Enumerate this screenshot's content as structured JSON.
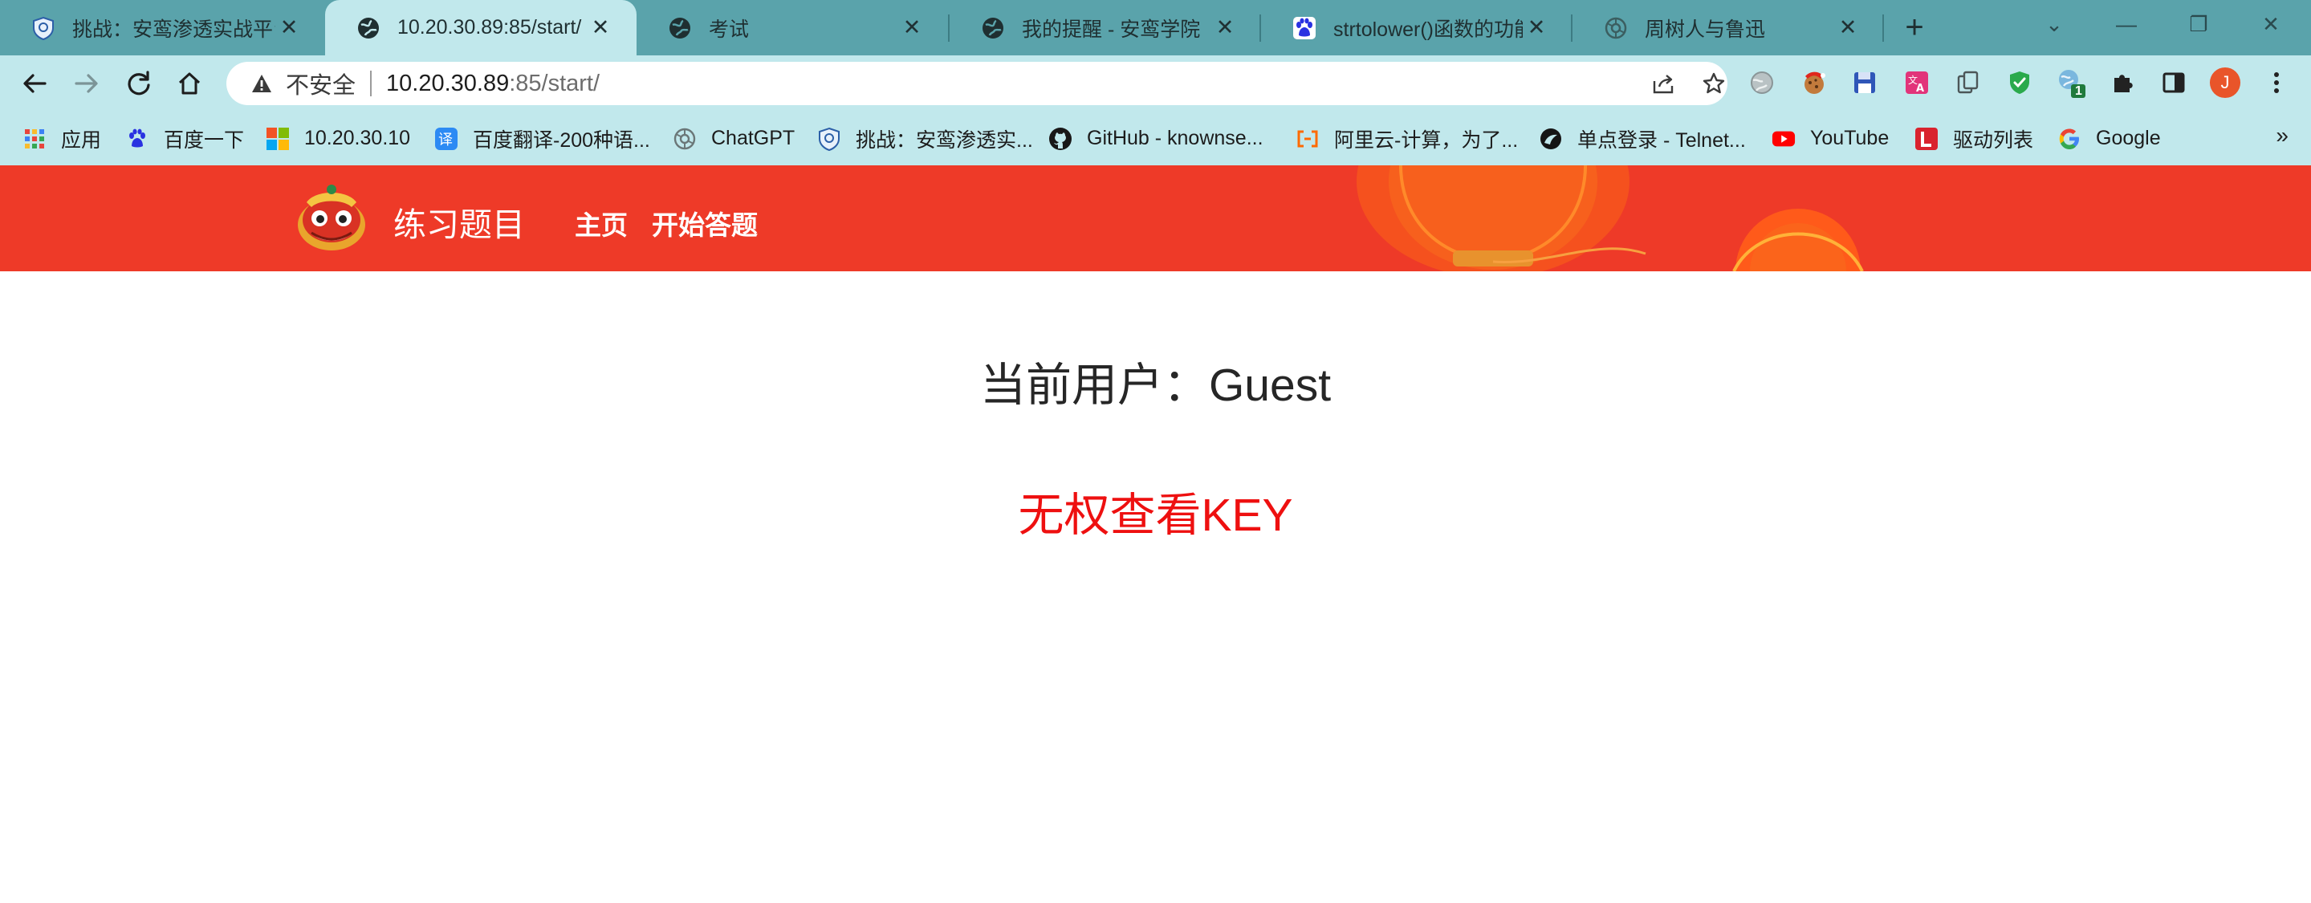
{
  "browser": {
    "tabs": [
      {
        "title": "挑战：安鸾渗透实战平台",
        "icon": "shield-icon",
        "active": false
      },
      {
        "title": "10.20.30.89:85/start/",
        "icon": "globe-icon",
        "active": true
      },
      {
        "title": "考试",
        "icon": "globe-icon",
        "active": false
      },
      {
        "title": "我的提醒 - 安鸾学院",
        "icon": "globe-icon",
        "active": false
      },
      {
        "title": "strtolower()函数的功能",
        "icon": "baidu-icon",
        "active": false
      },
      {
        "title": "周树人与鲁迅",
        "icon": "openai-icon",
        "active": false
      }
    ],
    "new_tab_symbol": "+",
    "window_controls": {
      "dropdown": "⌄",
      "minimize": "—",
      "restore": "❐",
      "close": "✕"
    },
    "address_bar": {
      "security_label": "不安全",
      "url_host": "10.20.30.89",
      "url_path": ":85/start/"
    },
    "profile_initial": "J",
    "extension_badge": "1",
    "bookmarks": [
      {
        "label": "应用",
        "icon": "apps-grid-icon"
      },
      {
        "label": "百度一下",
        "icon": "baidu-icon"
      },
      {
        "label": "10.20.30.10",
        "icon": "windows-icon"
      },
      {
        "label": "百度翻译-200种语...",
        "icon": "translate-icon"
      },
      {
        "label": "ChatGPT",
        "icon": "openai-icon"
      },
      {
        "label": "挑战：安鸾渗透实...",
        "icon": "shield-icon"
      },
      {
        "label": "GitHub - knownse...",
        "icon": "github-icon"
      },
      {
        "label": "阿里云-计算，为了...",
        "icon": "aliyun-icon"
      },
      {
        "label": "单点登录 - Telnet...",
        "icon": "telnet-icon"
      },
      {
        "label": "YouTube",
        "icon": "youtube-icon"
      },
      {
        "label": "驱动列表",
        "icon": "l-icon"
      },
      {
        "label": "Google",
        "icon": "google-icon"
      }
    ],
    "bookmarks_more": "»"
  },
  "site": {
    "title": "练习题目",
    "nav": [
      "主页",
      "开始答题"
    ],
    "header_color": "#ee3a28"
  },
  "content": {
    "user_line": "当前用户：Guest",
    "key_message": "无权查看KEY",
    "key_message_color": "#ee1010"
  }
}
